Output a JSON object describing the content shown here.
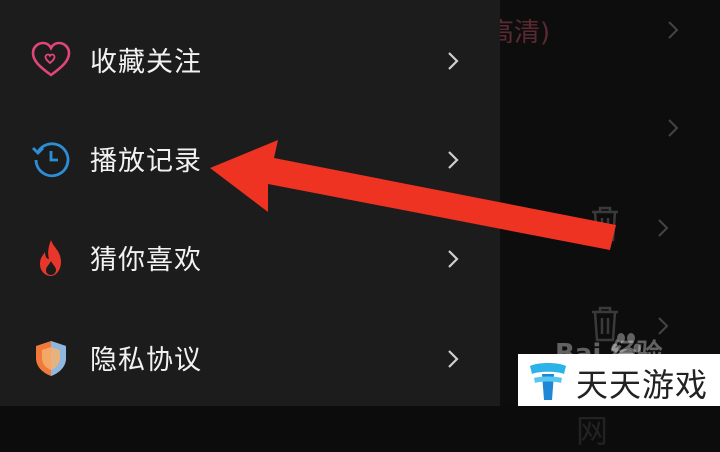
{
  "background": {
    "title_fragment": "高清)"
  },
  "menu": {
    "items": [
      {
        "label": "收藏关注",
        "icon": "heart-icon"
      },
      {
        "label": "播放记录",
        "icon": "history-clock-icon"
      },
      {
        "label": "猜你喜欢",
        "icon": "flame-icon"
      },
      {
        "label": "隐私协议",
        "icon": "shield-icon"
      }
    ]
  },
  "watermark": {
    "site_name": "天天游戏网",
    "baidu_text": "Bai 经验"
  },
  "colors": {
    "drawer_bg": "#1c1c1c",
    "page_bg": "#0d0d0d",
    "heart": "#e0457b",
    "clock": "#2c8fd6",
    "flame": "#e8362a",
    "shield_orange": "#f07a3a",
    "shield_blue": "#8fb8e0",
    "arrow": "#ee3322"
  }
}
